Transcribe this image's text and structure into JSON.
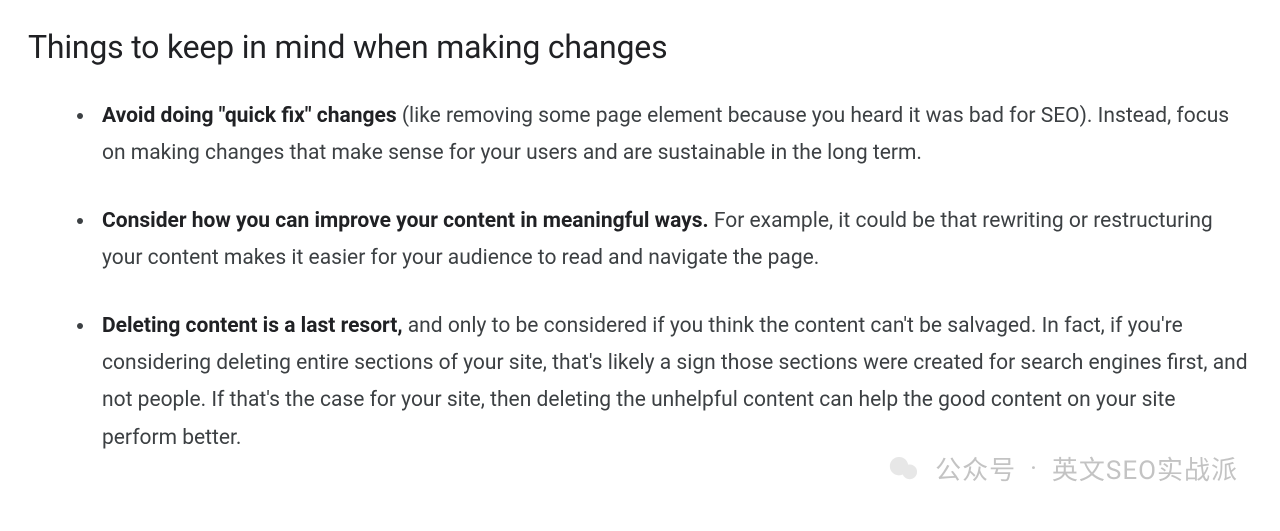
{
  "heading": "Things to keep in mind when making changes",
  "items": [
    {
      "bold": "Avoid doing \"quick fix\" changes",
      "rest": " (like removing some page element because you heard it was bad for SEO). Instead, focus on making changes that make sense for your users and are sustainable in the long term."
    },
    {
      "bold": "Consider how you can improve your content in meaningful ways.",
      "rest": " For example, it could be that rewriting or restructuring your content makes it easier for your audience to read and navigate the page."
    },
    {
      "bold": "Deleting content is a last resort,",
      "rest": " and only to be considered if you think the content can't be salvaged. In fact, if you're considering deleting entire sections of your site, that's likely a sign those sections were created for search engines first, and not people. If that's the case for your site, then deleting the unhelpful content can help the good content on your site perform better."
    }
  ],
  "watermark": {
    "label_left": "公众号",
    "label_right": "英文SEO实战派"
  }
}
